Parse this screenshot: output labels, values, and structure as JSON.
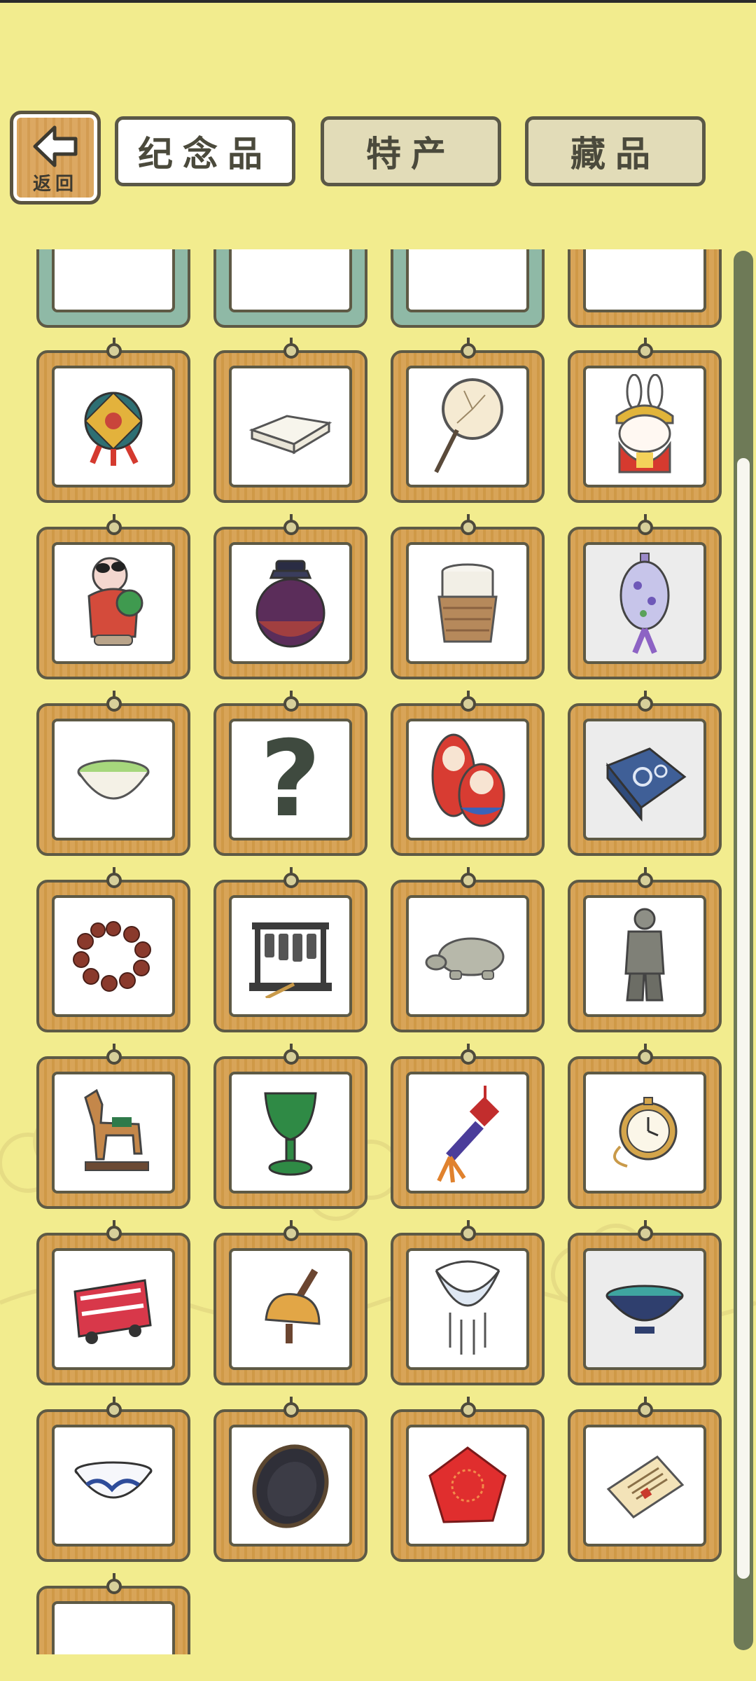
{
  "header": {
    "back_label": "返回",
    "tabs": [
      {
        "label": "纪念品",
        "state": "active"
      },
      {
        "label": "特产",
        "state": "inactive"
      },
      {
        "label": "藏品",
        "state": "inactive"
      }
    ]
  },
  "unknown_item_mark": "?",
  "grid": {
    "rows": [
      [
        "unknown-top",
        "unknown-top",
        "unknown-top",
        "unknown-top"
      ],
      [
        "temari-ball",
        "folded-cloth",
        "round-fan",
        "rabbit-doll"
      ],
      [
        "clay-figurine",
        "ceramic-jar",
        "woven-cup",
        "lantern-ornament"
      ],
      [
        "matcha-bowl",
        "unknown",
        "matryoshka-dolls",
        "blue-fabric"
      ],
      [
        "prayer-beads",
        "chime-bells",
        "stone-turtle",
        "terracotta-warrior"
      ],
      [
        "tang-horse",
        "jade-goblet",
        "chinese-knot",
        "pocket-watch"
      ],
      [
        "double-decker-bus",
        "bell-rattle",
        "silver-necklace",
        "tea-bowl"
      ],
      [
        "blue-white-bowl",
        "ink-stone",
        "red-handkerchief",
        "certificate"
      ],
      [
        "unknown-partial"
      ]
    ]
  },
  "colors": {
    "background": "#f2ec8e",
    "frame_wood": "#d6a153",
    "frame_teal": "#8fb9a6",
    "outline": "#5e5a45",
    "scroll_track": "#6e7a57"
  }
}
